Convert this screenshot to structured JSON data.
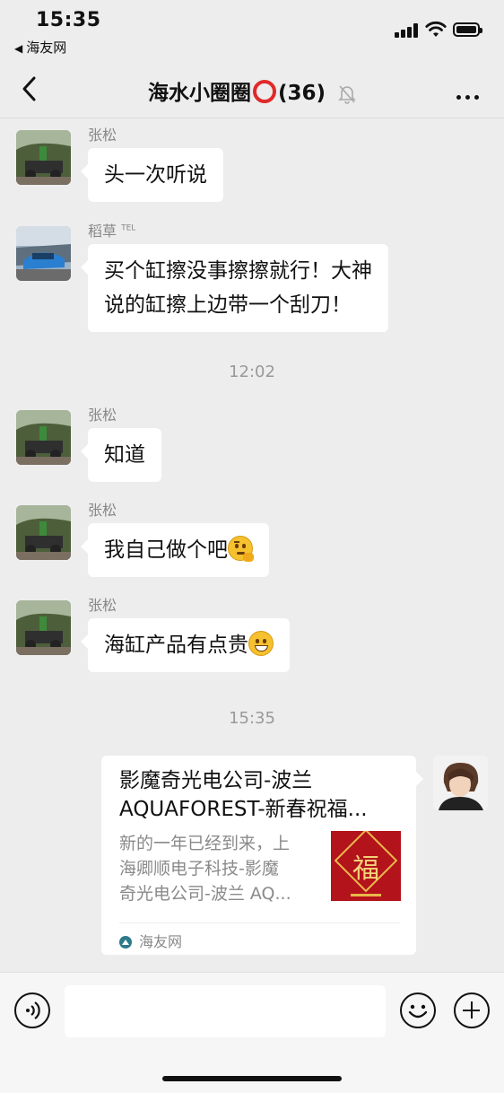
{
  "status": {
    "time": "15:35",
    "back_app": "海友网"
  },
  "nav": {
    "title": "海水小圈圈",
    "member_count": "(36)"
  },
  "messages": [
    {
      "sender": "张松",
      "text": "头一次听说"
    },
    {
      "sender": "稻草",
      "sender_badge": "TEL",
      "line1": "买个缸擦没事擦擦就行！大神",
      "line2": "说的缸擦上边带一个刮刀！"
    },
    {
      "sender": "张松",
      "text": "知道"
    },
    {
      "sender": "张松",
      "text": "我自己做个吧",
      "emoji": "thinking-emoji"
    },
    {
      "sender": "张松",
      "text": "海缸产品有点贵",
      "emoji": "grinning-emoji"
    }
  ],
  "timestamps": {
    "t1": "12:02",
    "t2": "15:35"
  },
  "link_card": {
    "title_line1": "影魔奇光电公司-波兰",
    "title_line2": "AQUAFOREST-新春祝福...",
    "desc_line1": "新的一年已经到来，上",
    "desc_line2": "海卿顺电子科技-影魔",
    "desc_line3": "奇光电公司-波兰 AQ...",
    "thumb_char": "福",
    "source": "海友网"
  }
}
